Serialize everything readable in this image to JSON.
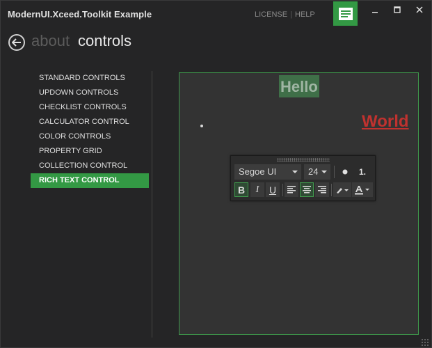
{
  "window": {
    "title": "ModernUI.Xceed.Toolkit Example",
    "links": [
      "LICENSE",
      "HELP"
    ],
    "accent": "#339944"
  },
  "header": {
    "breadcrumb_inactive": "about",
    "breadcrumb_active": "controls"
  },
  "sidebar": {
    "items": [
      {
        "label": "STANDARD CONTROLS"
      },
      {
        "label": "UPDOWN CONTROLS"
      },
      {
        "label": "CHECKLIST CONTROLS"
      },
      {
        "label": "CALCULATOR CONTROL"
      },
      {
        "label": "COLOR CONTROLS"
      },
      {
        "label": "PROPERTY GRID"
      },
      {
        "label": "COLLECTION CONTROL"
      },
      {
        "label": "RICH TEXT CONTROL"
      }
    ],
    "selected_index": 7
  },
  "editor": {
    "text_hello": "Hello",
    "text_world": "World",
    "world_color": "#c0322f"
  },
  "toolbar": {
    "font_family": "Segoe UI",
    "font_size": "24",
    "numbered_list_label": "1.",
    "bold_label": "B",
    "italic_label": "I",
    "underline_label": "U"
  }
}
